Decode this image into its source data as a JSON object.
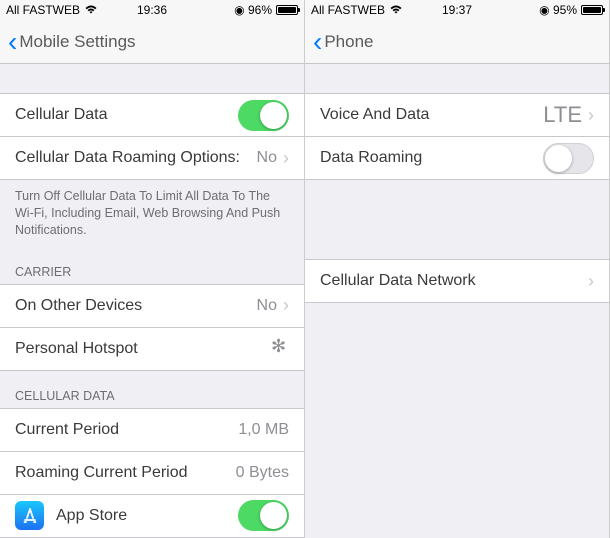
{
  "left": {
    "status": {
      "carrier": "All FASTWEB",
      "time": "19:36",
      "battery_pct": "96%"
    },
    "nav": {
      "title": "Mobile Settings"
    },
    "cellular_data": {
      "label": "Cellular Data",
      "on": true
    },
    "roaming_options": {
      "label": "Cellular Data Roaming Options:",
      "value": "No"
    },
    "footer": "Turn Off Cellular Data To Limit All Data To The Wi-Fi, Including Email, Web Browsing And Push Notifications.",
    "carrier_header": "CARRIER",
    "other_devices": {
      "label": "On Other Devices",
      "value": "No"
    },
    "hotspot": {
      "label": "Personal Hotspot"
    },
    "cellular_data_header": "CELLULAR DATA",
    "current_period": {
      "label": "Current Period",
      "value": "1,0 MB"
    },
    "roaming_period": {
      "label": "Roaming Current Period",
      "value": "0 Bytes"
    },
    "app_store": {
      "label": "App Store",
      "on": true
    }
  },
  "right": {
    "status": {
      "carrier": "All FASTWEB",
      "time": "19:37",
      "battery_pct": "95%"
    },
    "nav": {
      "title": "Phone"
    },
    "voice_data": {
      "label": "Voice And Data",
      "value": "LTE"
    },
    "data_roaming": {
      "label": "Data Roaming",
      "on": false
    },
    "cellular_network": {
      "label": "Cellular Data Network"
    }
  }
}
